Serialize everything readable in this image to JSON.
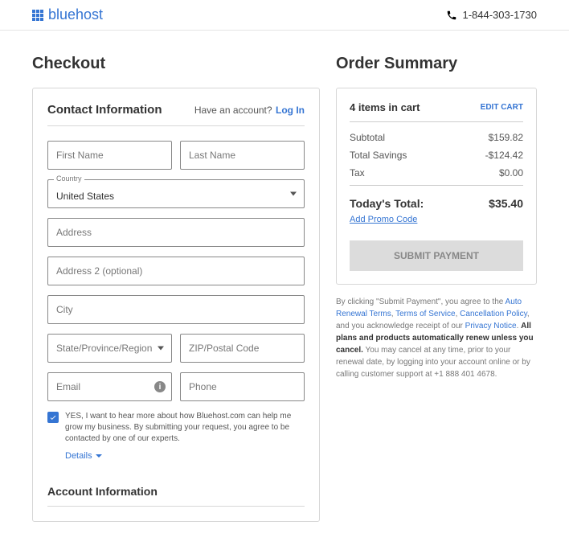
{
  "header": {
    "brand": "bluehost",
    "phone": "1-844-303-1730"
  },
  "checkout": {
    "title": "Checkout",
    "contact_heading": "Contact Information",
    "have_account": "Have an account?",
    "login": "Log In",
    "fields": {
      "first_name": "First Name",
      "last_name": "Last Name",
      "country_label": "Country",
      "country_value": "United States",
      "address": "Address",
      "address2": "Address 2 (optional)",
      "city": "City",
      "state": "State/Province/Region",
      "zip": "ZIP/Postal Code",
      "email": "Email",
      "phone": "Phone"
    },
    "consent": "YES, I want to hear more about how Bluehost.com can help me grow my business. By submitting your request, you agree to be contacted by one of our experts.",
    "details": "Details",
    "account_heading": "Account Information"
  },
  "summary": {
    "title": "Order Summary",
    "items_count_label": "4 items in cart",
    "edit_cart": "EDIT CART",
    "lines": {
      "subtotal_label": "Subtotal",
      "subtotal_value": "$159.82",
      "savings_label": "Total Savings",
      "savings_value": "-$124.42",
      "tax_label": "Tax",
      "tax_value": "$0.00"
    },
    "total_label": "Today's Total:",
    "total_value": "$35.40",
    "promo": "Add Promo Code",
    "submit": "SUBMIT PAYMENT",
    "legal_pre": "By clicking \"Submit Payment\", you agree to the ",
    "legal_auto": "Auto Renewal Terms",
    "legal_tos": "Terms of Service",
    "legal_cancel": "Cancellation Policy",
    "legal_ack": ", and you acknowledge receipt of our ",
    "legal_privacy": "Privacy Notice",
    "legal_bold": "All plans and products automatically renew unless you cancel.",
    "legal_tail": " You may cancel at any time, prior to your renewal date, by logging into your account online or by calling customer support at +1 888 401 4678."
  }
}
